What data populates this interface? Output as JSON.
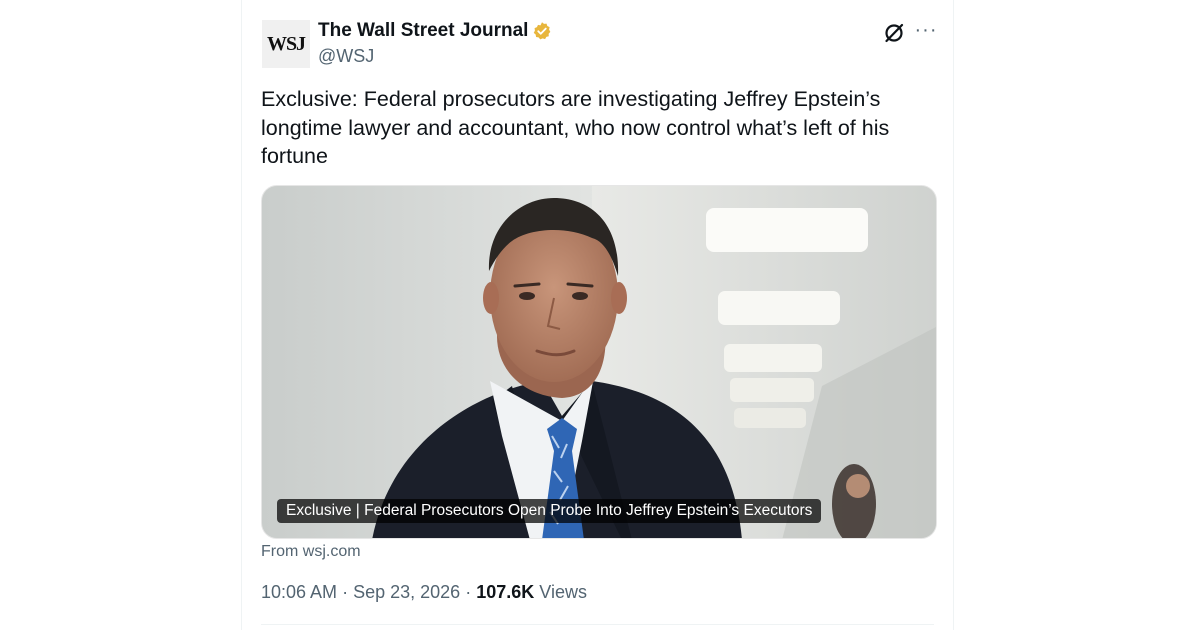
{
  "account": {
    "avatar_text": "WSJ",
    "display_name": "The Wall Street Journal",
    "handle": "@WSJ",
    "verified_badge_color": "#e8b63d",
    "verified_icon": "verified-badge-icon"
  },
  "actions": {
    "grok_icon": "grok-icon",
    "more_icon": "more-icon",
    "more_label": "···"
  },
  "tweet": {
    "text": "Exclusive: Federal prosecutors are investigating Jeffrey Epstein’s\nlongtime lawyer and accountant, who now control what’s left of his\nfortune"
  },
  "media": {
    "caption": "Exclusive | Federal Prosecutors Open Probe Into Jeffrey Epstein’s Executors"
  },
  "link_source": "From wsj.com",
  "meta": {
    "time": "10:06 AM",
    "separator": "·",
    "date": "Sep 23, 2026",
    "views_count": "107.6K",
    "views_label": "Views"
  }
}
